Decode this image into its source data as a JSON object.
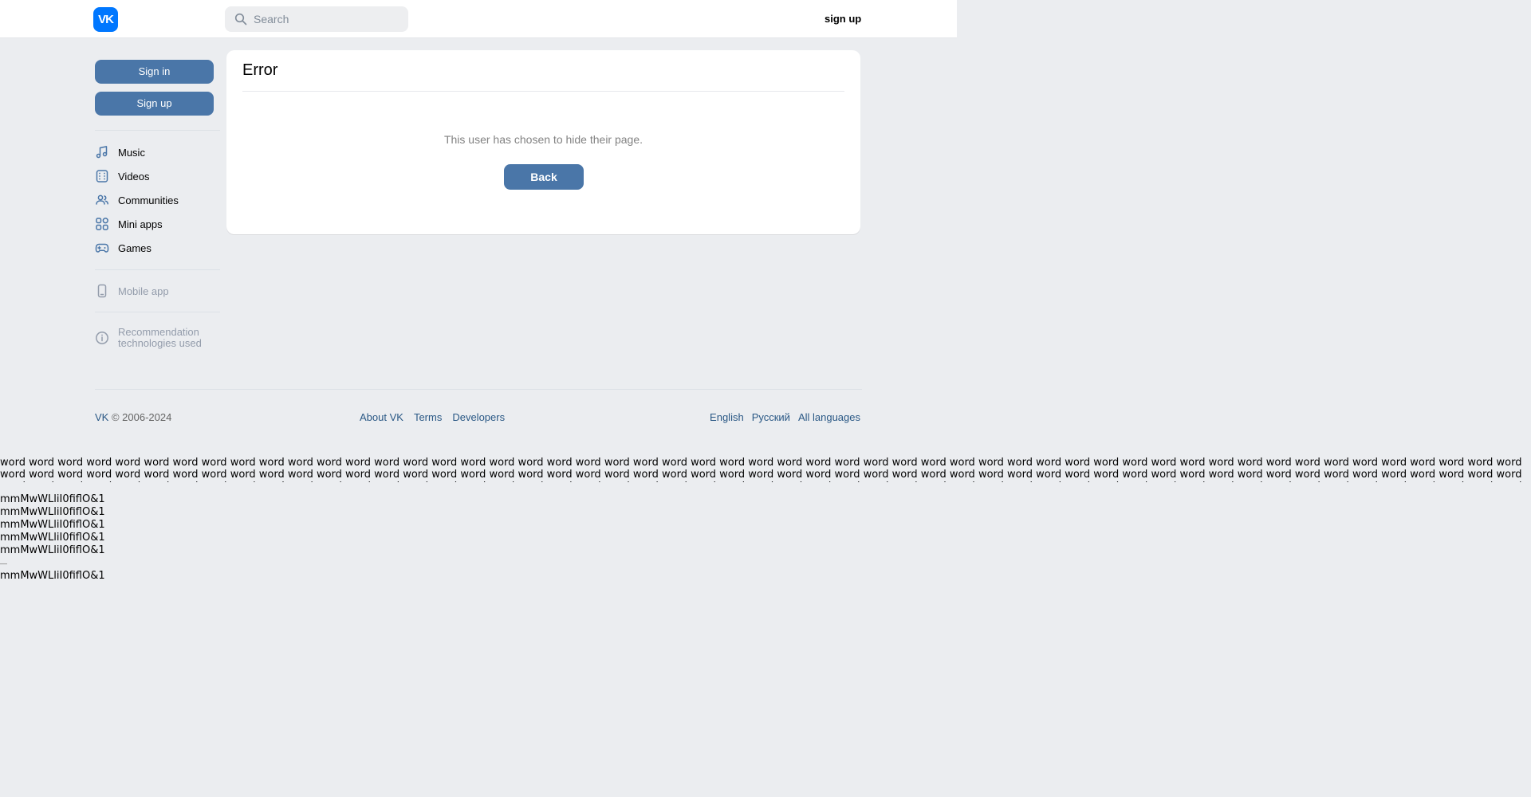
{
  "header": {
    "logo_text": "VK",
    "search_placeholder": "Search",
    "signup_label": "sign up"
  },
  "sidebar": {
    "signin_label": "Sign in",
    "signup_label": "Sign up",
    "nav": [
      {
        "label": "Music",
        "icon": "music-note-icon"
      },
      {
        "label": "Videos",
        "icon": "video-icon"
      },
      {
        "label": "Communities",
        "icon": "communities-icon"
      },
      {
        "label": "Mini apps",
        "icon": "grid-icon"
      },
      {
        "label": "Games",
        "icon": "gamepad-icon"
      }
    ],
    "mobile_app": "Mobile app",
    "recommendation": "Recommendation technologies used"
  },
  "card": {
    "title": "Error",
    "message": "This user has chosen to hide their page.",
    "back_label": "Back"
  },
  "footer": {
    "brand": "VK",
    "copyright": " © 2006-2024",
    "links": [
      "About VK",
      "Terms",
      "Developers"
    ],
    "languages": [
      "English",
      "Русский",
      "All languages"
    ]
  },
  "filler": {
    "word": "word",
    "word_count": 224,
    "line_text": "mmMwWLliI0fiflO&1"
  },
  "colors": {
    "accent": "#4a76a8",
    "brand": "#0077ff",
    "link": "#2a5885",
    "background": "#ebedf0"
  }
}
